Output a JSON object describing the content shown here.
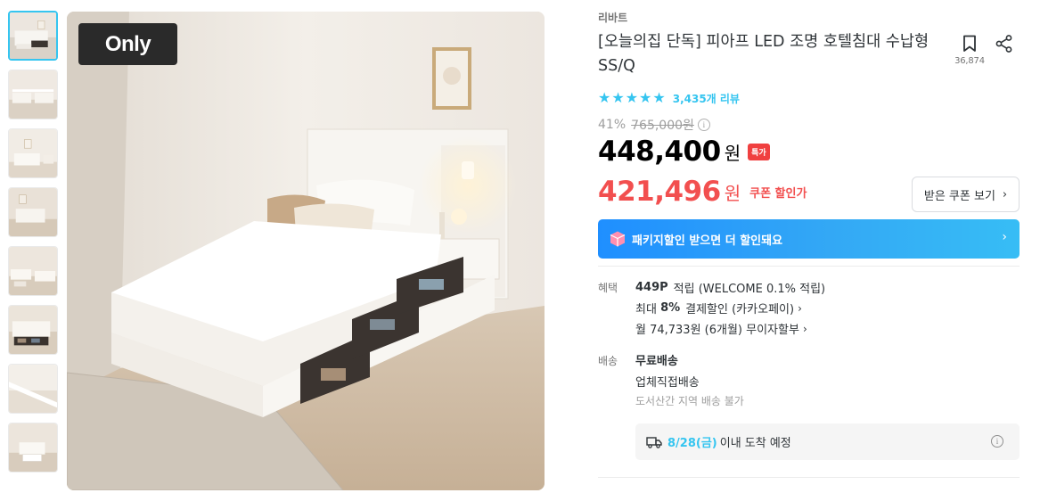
{
  "gallery": {
    "badge": "Only",
    "thumbnails": [
      {
        "name": "thumb-1",
        "active": true
      },
      {
        "name": "thumb-2",
        "active": false
      },
      {
        "name": "thumb-3",
        "active": false
      },
      {
        "name": "thumb-4",
        "active": false
      },
      {
        "name": "thumb-5",
        "active": false
      },
      {
        "name": "thumb-6",
        "active": false
      },
      {
        "name": "thumb-7",
        "active": false
      },
      {
        "name": "thumb-8",
        "active": false
      }
    ]
  },
  "product": {
    "brand": "리바트",
    "title": "[오늘의집 단독] 피아프 LED 조명 호텔침대 수납형 SS/Q",
    "bookmark_count": "36,874",
    "rating_stars": 5,
    "review_count": "3,435개 리뷰"
  },
  "pricing": {
    "discount_pct": "41%",
    "original_price": "765,000원",
    "price": "448,400",
    "won": "원",
    "special_badge": "특가",
    "coupon_price": "421,496",
    "coupon_won": "원",
    "coupon_label": "쿠폰 할인가",
    "coupon_button": "받은 쿠폰 보기"
  },
  "package_banner": {
    "text": "패키지할인 받으면 더 할인돼요"
  },
  "benefits": {
    "label": "혜택",
    "points": "449P",
    "points_text": "적립 (WELCOME 0.1% 적립)",
    "max_prefix": "최대",
    "max_pct": "8%",
    "max_text": "결제할인 (카카오페이)",
    "installment": "월 74,733원 (6개월) 무이자할부"
  },
  "shipping": {
    "label": "배송",
    "free": "무료배송",
    "method": "업체직접배송",
    "restriction": "도서산간 지역 배송 불가",
    "arrival_date": "8/28(금)",
    "arrival_text": "이내 도착 예정"
  },
  "colors": {
    "accent": "#35c5f0",
    "sale": "#f24f4f",
    "badge_red": "#f04040",
    "banner_blue": "#1f8fff"
  }
}
